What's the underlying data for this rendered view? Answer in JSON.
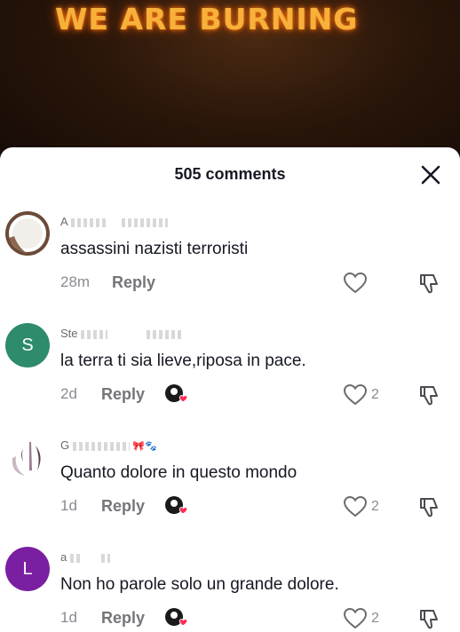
{
  "video": {
    "overlay_title": "WE ARE BURNING"
  },
  "sheet": {
    "comment_count": "505 comments",
    "close_icon": "close-x-icon"
  },
  "comments": [
    {
      "avatar_type": "photo",
      "username": "A",
      "text": "assassini nazisti terroristi",
      "time": "28m",
      "reply_label": "Reply",
      "likes": "",
      "liked_by_creator": false
    },
    {
      "avatar_type": "letter",
      "avatar_letter": "S",
      "avatar_color": "#2e8b6b",
      "username": "Ste",
      "text": "la terra ti sia lieve,riposa in pace.",
      "time": "2d",
      "reply_label": "Reply",
      "likes": "2",
      "liked_by_creator": true
    },
    {
      "avatar_type": "photo",
      "username": "G",
      "text": "Quanto dolore in questo mondo",
      "time": "1d",
      "reply_label": "Reply",
      "likes": "2",
      "liked_by_creator": true
    },
    {
      "avatar_type": "letter",
      "avatar_letter": "L",
      "avatar_color": "#7b1fa2",
      "username": "a",
      "text": "Non ho parole solo un grande dolore.",
      "time": "1d",
      "reply_label": "Reply",
      "likes": "2",
      "liked_by_creator": true
    }
  ],
  "colors": {
    "text_primary": "#161823",
    "text_secondary": "#8a8b91",
    "creator_heart": "#fe2c55"
  }
}
